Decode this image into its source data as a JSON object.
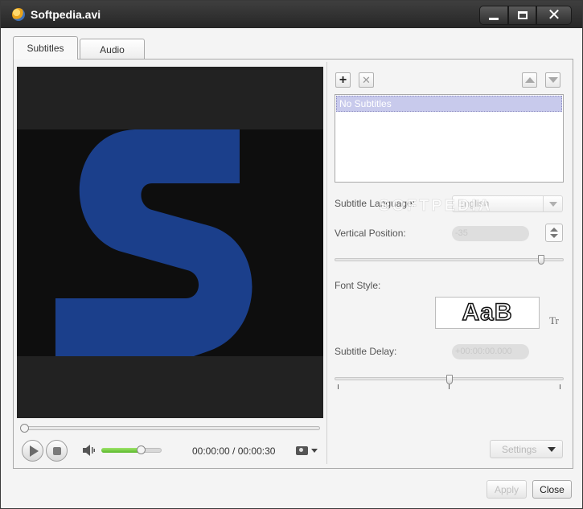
{
  "window": {
    "title": "Softpedia.avi",
    "controls": {
      "minimize": "minimize",
      "maximize": "maximize",
      "close": "close"
    }
  },
  "tabs": [
    {
      "label": "Subtitles",
      "active": true
    },
    {
      "label": "Audio",
      "active": false
    }
  ],
  "player": {
    "time_current": "00:00:00",
    "time_separator": " / ",
    "time_total": "00:00:30",
    "seek_progress": 0.0,
    "volume_level": 0.66
  },
  "subtitles": {
    "list_items": [
      "No Subtitles"
    ],
    "language_label": "Subtitle Language:",
    "language_value": "English",
    "vertical_position_label": "Vertical Position:",
    "vertical_position_value": "-35",
    "vertical_slider_level": 0.9,
    "font_style_label": "Font Style:",
    "font_preview_text": "AaB",
    "delay_label": "Subtitle Delay:",
    "delay_value": "+00:00:00.000",
    "delay_slider_level": 0.5,
    "settings_label": "Settings"
  },
  "footer": {
    "apply_label": "Apply",
    "close_label": "Close"
  },
  "watermark": "SOFTPEDIA",
  "colors": {
    "titlebar": "#2f2f2f",
    "accent_blue": "#1b3f8b",
    "selection": "#c8caec",
    "volume_green": "#6cc83a"
  }
}
